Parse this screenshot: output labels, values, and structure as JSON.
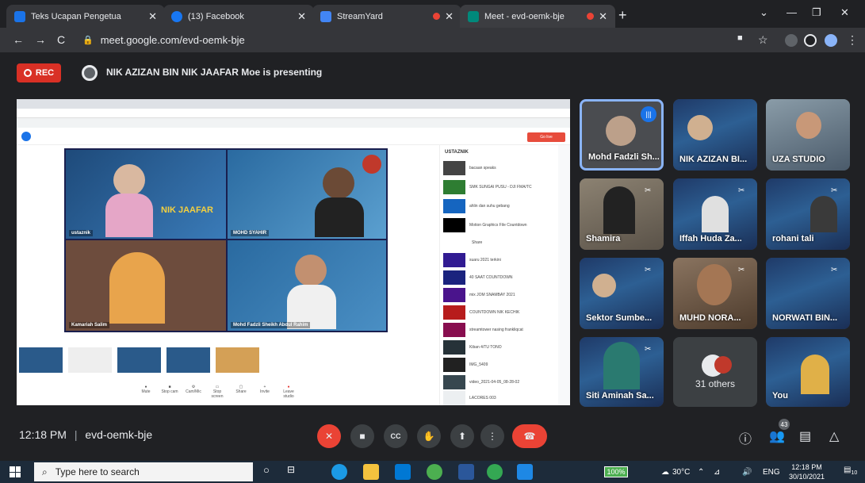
{
  "browser": {
    "tabs": [
      {
        "title": "Teks Ucapan Pengetua",
        "color": "#1a73e8",
        "recording": false
      },
      {
        "title": "(13) Facebook",
        "color": "#1877f2",
        "recording": false
      },
      {
        "title": "StreamYard",
        "color": "#4285f4",
        "recording": true
      },
      {
        "title": "Meet - evd-oemk-bje",
        "color": "#00897b",
        "recording": true
      }
    ],
    "url": "meet.google.com/evd-oemk-bje"
  },
  "meet": {
    "rec_label": "REC",
    "presenting_text": "NIK AZIZAN BIN NIK JAAFAR Moe is presenting",
    "meeting_code": "evd-oemk-bje",
    "time": "12:18 PM",
    "participants_count": "43",
    "presentation": {
      "cells": [
        {
          "label": "ustaznik"
        },
        {
          "label": "MOHD SYAHIR"
        },
        {
          "label": "Kamariah Salim"
        },
        {
          "label": "Mohd Fadzli Sheikh Abdul Rahim"
        }
      ],
      "banner_text": "NIK JAAFAR",
      "right_panel_title": "USTAZNIK",
      "right_panel_items": [
        "bacaan speaks",
        "SMK SUNGAI PUSU - DJI FMA/TC",
        "ahlin dan suhu gebang",
        "Motion Graphics File Countdown",
        "Share",
        "suaru 2021 terkini",
        "40 SAAT COUNTDOWN",
        "mix JOM SNAMBAY 2021",
        "COUNTDOWN NIK KECHIK",
        "streamtower nasing frankliqcat",
        "Kiban 4/TU TONO",
        "IMG_5409",
        "video_2021-04-05_08-28-02",
        "LACORES 003"
      ],
      "controls": [
        "Mute",
        "Stop cam",
        "Cam/Mic",
        "Stop screen",
        "Share",
        "Invite",
        "Leave studio"
      ]
    },
    "tiles": [
      {
        "name": "Mohd Fadzli Sh..."
      },
      {
        "name": "NIK AZIZAN BI..."
      },
      {
        "name": "UZA STUDIO"
      },
      {
        "name": "Shamira"
      },
      {
        "name": "Iffah Huda Za..."
      },
      {
        "name": "rohani tali"
      },
      {
        "name": "Sektor Sumbe..."
      },
      {
        "name": "MUHD NORA..."
      },
      {
        "name": "NORWATI BIN..."
      },
      {
        "name": "Siti Aminah Sa..."
      },
      {
        "name": "31 others"
      },
      {
        "name": "You"
      }
    ]
  },
  "taskbar": {
    "search_placeholder": "Type here to search",
    "battery": "100%",
    "temperature": "30°C",
    "language": "ENG",
    "clock_time": "12:18 PM",
    "clock_date": "30/10/2021",
    "notifications": "10"
  }
}
